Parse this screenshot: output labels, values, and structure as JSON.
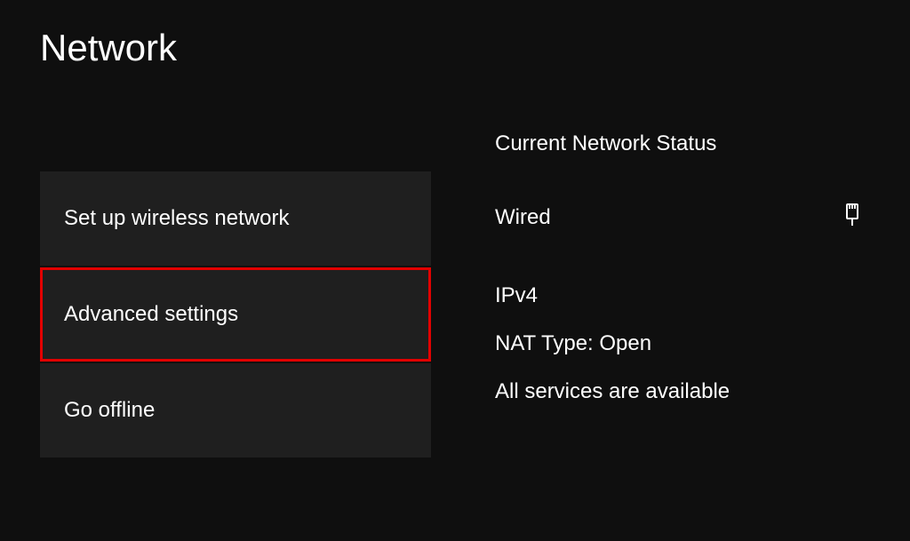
{
  "page": {
    "title": "Network"
  },
  "menu": {
    "items": [
      {
        "label": "Set up wireless network"
      },
      {
        "label": "Advanced settings"
      },
      {
        "label": "Go offline"
      }
    ]
  },
  "status": {
    "heading": "Current Network Status",
    "connection_type": "Wired",
    "ip_version": "IPv4",
    "nat_type": "NAT Type: Open",
    "services": "All services are available"
  }
}
